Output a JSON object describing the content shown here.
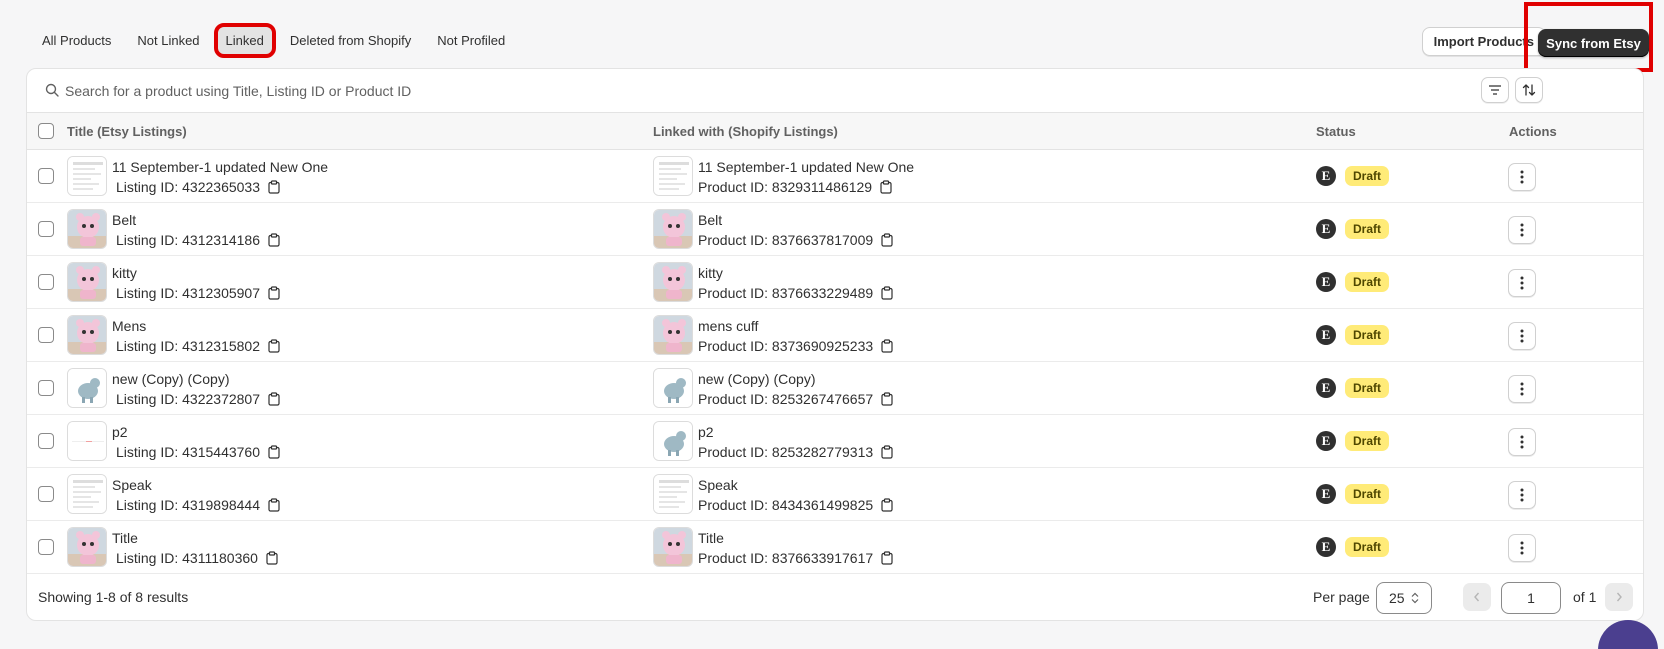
{
  "tabs": [
    "All Products",
    "Not Linked",
    "Linked",
    "Deleted from Shopify",
    "Not Profiled"
  ],
  "active_tab": "Linked",
  "buttons": {
    "import": "Import Products",
    "sync": "Sync from Etsy"
  },
  "search": {
    "placeholder": "Search for a product using Title, Listing ID or Product ID"
  },
  "columns": {
    "title": "Title (Etsy Listings)",
    "linked": "Linked with (Shopify Listings)",
    "status": "Status",
    "actions": "Actions"
  },
  "rows": [
    {
      "title": "11 September-1 updated New One",
      "listing": "Listing ID: 4322365033",
      "shopify_title": "11 September-1 updated New One",
      "product": "Product ID: 8329311486129",
      "status": "Draft",
      "etsy": "E"
    },
    {
      "title": "Belt",
      "listing": "Listing ID: 4312314186",
      "shopify_title": "Belt",
      "product": "Product ID: 8376637817009",
      "status": "Draft",
      "etsy": "E"
    },
    {
      "title": "kitty",
      "listing": "Listing ID: 4312305907",
      "shopify_title": "kitty",
      "product": "Product ID: 8376633229489",
      "status": "Draft",
      "etsy": "E"
    },
    {
      "title": "Mens",
      "listing": "Listing ID: 4312315802",
      "shopify_title": "mens cuff",
      "product": "Product ID: 8373690925233",
      "status": "Draft",
      "etsy": "E"
    },
    {
      "title": "new (Copy) (Copy)",
      "listing": "Listing ID: 4322372807",
      "shopify_title": "new (Copy) (Copy)",
      "product": "Product ID: 8253267476657",
      "status": "Draft",
      "etsy": "E"
    },
    {
      "title": "p2",
      "listing": "Listing ID: 4315443760",
      "shopify_title": "p2",
      "product": "Product ID: 8253282779313",
      "status": "Draft",
      "etsy": "E"
    },
    {
      "title": "Speak",
      "listing": "Listing ID: 4319898444",
      "shopify_title": "Speak",
      "product": "Product ID: 8434361499825",
      "status": "Draft",
      "etsy": "E"
    },
    {
      "title": "Title",
      "listing": "Listing ID: 4311180360",
      "shopify_title": "Title",
      "product": "Product ID: 8376633917617",
      "status": "Draft",
      "etsy": "E"
    }
  ],
  "footer": {
    "showing": "Showing 1-8 of 8 results",
    "per_page_label": "Per page",
    "per_page_value": "25",
    "page": "1",
    "of_pages": "of 1"
  }
}
